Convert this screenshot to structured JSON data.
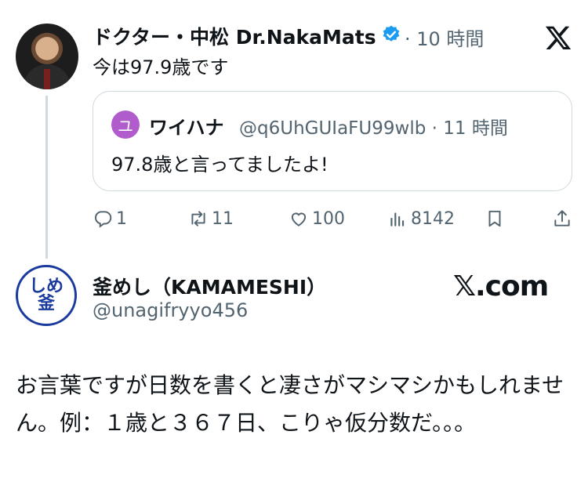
{
  "tweet": {
    "author_name": "ドクター・中松 Dr.NakaMats",
    "time": "· 10 時間",
    "text": "今は97.9歳です"
  },
  "quote": {
    "avatar_letter": "ユ",
    "author_name": "ワイハナ",
    "handle_time": "@q6UhGUIaFU99wlb · 11 時間",
    "text": "97.8歳と言ってましたよ!"
  },
  "actions": {
    "replies": "1",
    "reposts": "11",
    "likes": "100",
    "views": "8142"
  },
  "reply": {
    "avatar_text_top": "しめ",
    "avatar_text_bottom": "釜",
    "author_name": "釜めし（KAMAMESHI）",
    "handle": "@unagifryyo456",
    "brand": "𝕏.com",
    "text": "お言葉ですが日数を書くと凄さがマシマシかもしれません。例：１歳と３６７日、こりゃ仮分数だ。。。"
  },
  "icons": [
    "verified-badge-icon",
    "x-logo-icon",
    "reply-icon",
    "repost-icon",
    "like-icon",
    "views-icon",
    "bookmark-icon",
    "share-icon"
  ],
  "colors": {
    "verified": "#1d9bf0",
    "muted": "#536471",
    "quote_avatar": "#b05ccc",
    "stamp": "#1a3a9e"
  }
}
